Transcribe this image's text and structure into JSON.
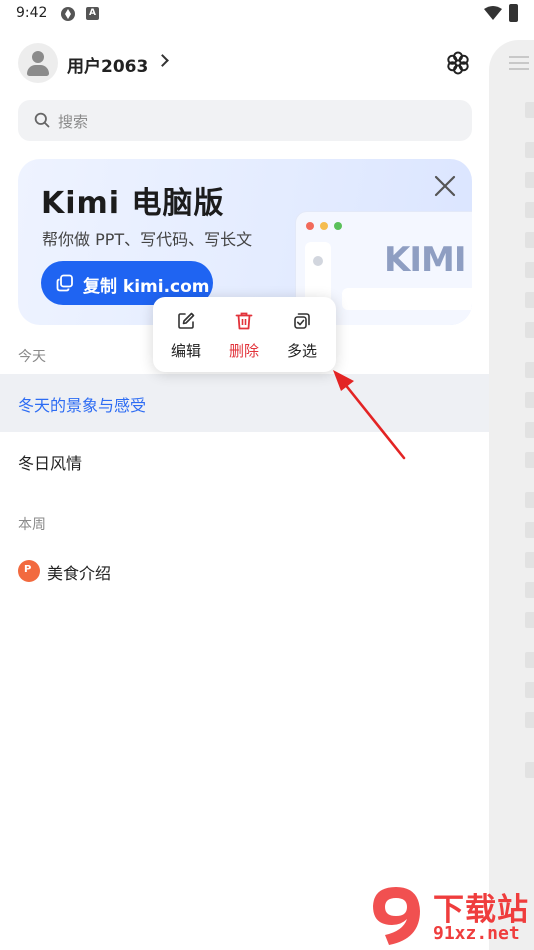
{
  "status_bar": {
    "time": "9:42"
  },
  "user": {
    "name": "用户2063"
  },
  "search": {
    "placeholder": "搜索"
  },
  "banner": {
    "title": "Kimi 电脑版",
    "subtitle": "帮你做 PPT、写代码、写长文",
    "button_label": "复制 kimi.com",
    "mock_logo": "KIMI"
  },
  "sections": {
    "today": "今天",
    "this_week": "本周"
  },
  "conversations": [
    {
      "title": "冬天的景象与感受",
      "section": "today",
      "active": true
    },
    {
      "title": "冬日风情",
      "section": "today",
      "active": false
    },
    {
      "title": "美食介绍",
      "section": "this_week",
      "icon": "ppt-icon",
      "icon_letter": "P"
    }
  ],
  "context_menu": {
    "items": [
      {
        "label": "编辑",
        "icon": "edit-icon"
      },
      {
        "label": "删除",
        "icon": "trash-icon",
        "color": "#e2333b"
      },
      {
        "label": "多选",
        "icon": "multiselect-icon"
      }
    ]
  },
  "watermark": {
    "brand": "下载站",
    "url": "91xz.net"
  },
  "colors": {
    "accent": "#2d6cf3",
    "danger": "#e2333b",
    "button": "#1f64f2",
    "watermark": "#ef3d3d"
  }
}
